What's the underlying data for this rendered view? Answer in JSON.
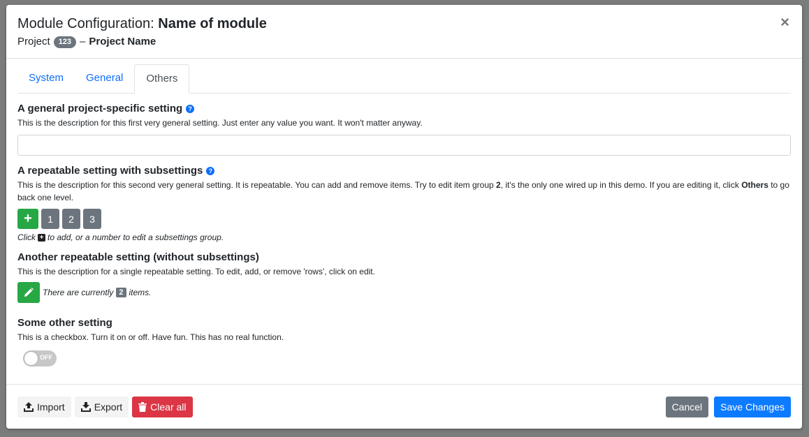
{
  "header": {
    "title_prefix": "Module Configuration:",
    "title_name": "Name of module",
    "project_label": "Project",
    "project_id": "123",
    "separator": "–",
    "project_name": "Project Name",
    "close_glyph": "×"
  },
  "tabs": [
    {
      "label": "System",
      "active": false
    },
    {
      "label": "General",
      "active": false
    },
    {
      "label": "Others",
      "active": true
    }
  ],
  "settings": {
    "general": {
      "title": "A general project-specific setting",
      "description": "This is the description for this first very general setting. Just enter any value you want. It won't matter anyway.",
      "value": "",
      "icon": "question-circle-icon"
    },
    "repeatable": {
      "title": "A repeatable setting with subsettings",
      "desc_part1": "This is the description for this second very general setting. It is repeatable. You can add and remove items. Try to edit item group ",
      "desc_bold1": "2",
      "desc_part2": ", it's the only one wired up in this demo. If you are editing it, click ",
      "desc_bold2": "Others",
      "desc_part3": " to go back one level.",
      "add_glyph": "+",
      "groups": [
        "1",
        "2",
        "3"
      ],
      "hint_prefix": "Click",
      "hint_suffix": "to add, or a number to edit a subsettings group.",
      "icon": "question-circle-icon"
    },
    "another": {
      "title": "Another repeatable setting (without subsettings)",
      "description": "This is the description for a single repeatable setting. To edit, add, or remove 'rows', click on edit.",
      "count_prefix": "There are currently",
      "count": "2",
      "count_suffix": "items.",
      "icon": "pencil-icon"
    },
    "other": {
      "title": "Some other setting",
      "description": "This is a checkbox. Turn it on or off. Have fun. This has no real function.",
      "toggle_label": "OFF",
      "toggle_on": false
    }
  },
  "footer": {
    "import_label": "Import",
    "export_label": "Export",
    "clear_label": "Clear all",
    "cancel_label": "Cancel",
    "save_label": "Save Changes"
  },
  "colors": {
    "primary": "#0d7bff",
    "success": "#28a745",
    "danger": "#dc3545",
    "secondary": "#6c757d"
  }
}
